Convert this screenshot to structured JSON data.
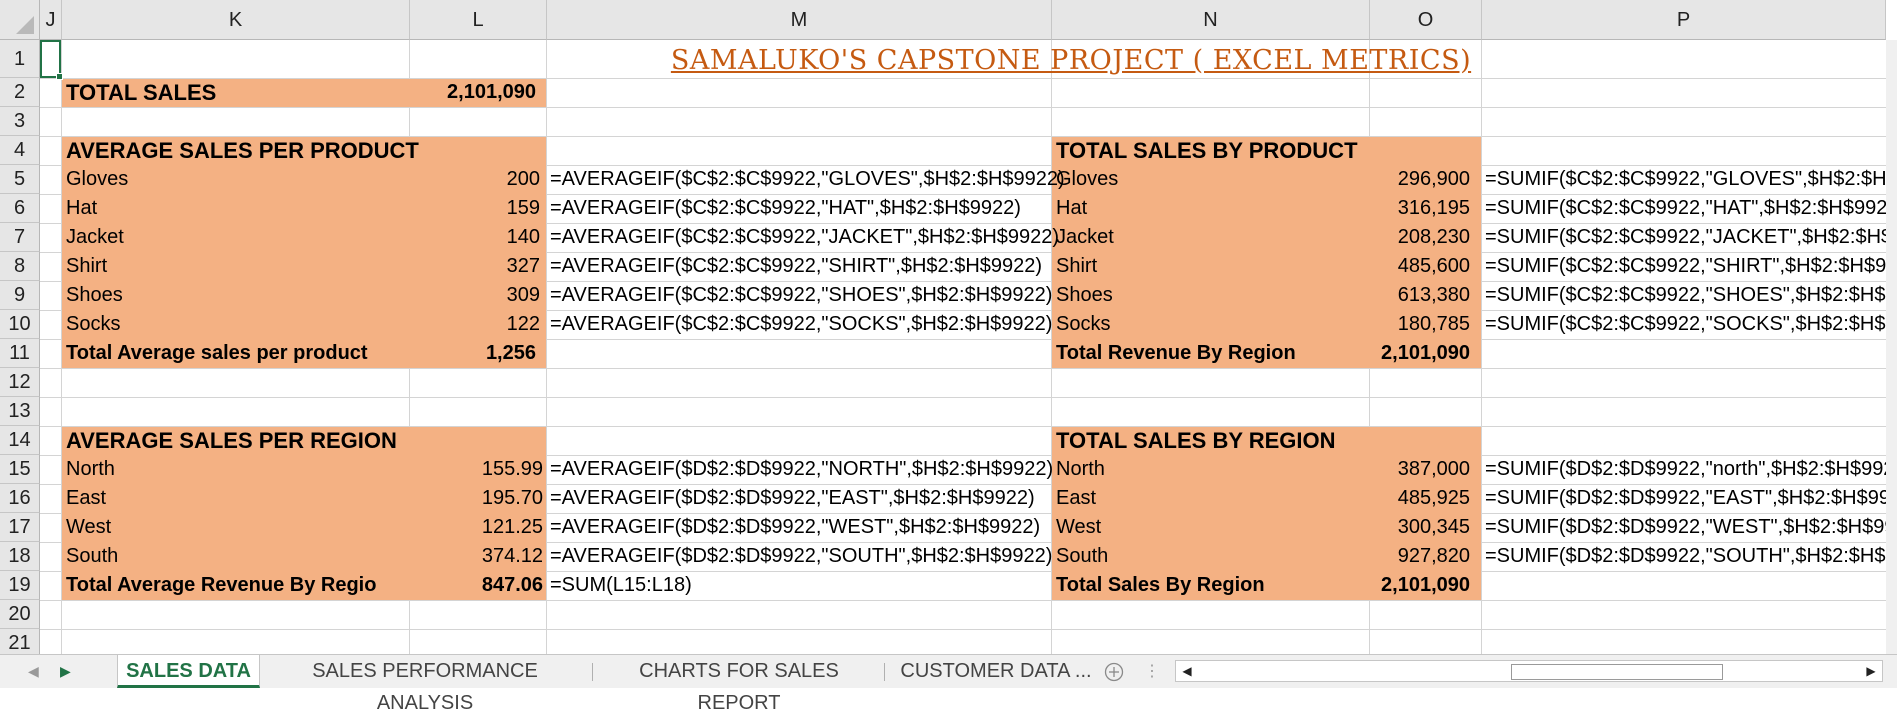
{
  "columns": [
    "J",
    "K",
    "L",
    "M",
    "N",
    "O",
    "P"
  ],
  "rows": [
    "1",
    "2",
    "3",
    "4",
    "5",
    "6",
    "7",
    "8",
    "9",
    "10",
    "11",
    "12",
    "13",
    "14",
    "15",
    "16",
    "17",
    "18",
    "19",
    "20",
    "21"
  ],
  "title": "SAMALUKO'S  CAPSTONE PROJECT ( EXCEL METRICS)",
  "total_sales": {
    "label": "TOTAL SALES",
    "value": "2,101,090"
  },
  "avg_product": {
    "header": "AVERAGE SALES PER PRODUCT",
    "items": [
      {
        "name": "Gloves",
        "value": "200",
        "formula": "=AVERAGEIF($C$2:$C$9922,\"GLOVES\",$H$2:$H$9922)"
      },
      {
        "name": "Hat",
        "value": "159",
        "formula": "=AVERAGEIF($C$2:$C$9922,\"HAT\",$H$2:$H$9922)"
      },
      {
        "name": "Jacket",
        "value": "140",
        "formula": "=AVERAGEIF($C$2:$C$9922,\"JACKET\",$H$2:$H$9922)"
      },
      {
        "name": "Shirt",
        "value": "327",
        "formula": "=AVERAGEIF($C$2:$C$9922,\"SHIRT\",$H$2:$H$9922)"
      },
      {
        "name": "Shoes",
        "value": "309",
        "formula": "=AVERAGEIF($C$2:$C$9922,\"SHOES\",$H$2:$H$9922)"
      },
      {
        "name": "Socks",
        "value": "122",
        "formula": "=AVERAGEIF($C$2:$C$9922,\"SOCKS\",$H$2:$H$9922)"
      }
    ],
    "total_label": "Total Average sales per product",
    "total_value": "1,256"
  },
  "total_product": {
    "header": "TOTAL SALES BY PRODUCT",
    "items": [
      {
        "name": "Gloves",
        "value": "296,900",
        "formula": "=SUMIF($C$2:$C$9922,\"GLOVES\",$H$2:$H$9"
      },
      {
        "name": "Hat",
        "value": "316,195",
        "formula": "=SUMIF($C$2:$C$9922,\"HAT\",$H$2:$H$9922"
      },
      {
        "name": "Jacket",
        "value": "208,230",
        "formula": "=SUMIF($C$2:$C$9922,\"JACKET\",$H$2:$H$99"
      },
      {
        "name": "Shirt",
        "value": "485,600",
        "formula": "=SUMIF($C$2:$C$9922,\"SHIRT\",$H$2:$H$992"
      },
      {
        "name": "Shoes",
        "value": "613,380",
        "formula": "=SUMIF($C$2:$C$9922,\"SHOES\",$H$2:$H$99"
      },
      {
        "name": "Socks",
        "value": "180,785",
        "formula": "=SUMIF($C$2:$C$9922,\"SOCKS\",$H$2:$H$99"
      }
    ],
    "total_label": "Total Revenue By Region",
    "total_value": "2,101,090"
  },
  "avg_region": {
    "header": "AVERAGE SALES PER REGION",
    "items": [
      {
        "name": "North",
        "value": "155.99",
        "formula": "=AVERAGEIF($D$2:$D$9922,\"NORTH\",$H$2:$H$9922)"
      },
      {
        "name": "East",
        "value": "195.70",
        "formula": "=AVERAGEIF($D$2:$D$9922,\"EAST\",$H$2:$H$9922)"
      },
      {
        "name": "West",
        "value": "121.25",
        "formula": "=AVERAGEIF($D$2:$D$9922,\"WEST\",$H$2:$H$9922)"
      },
      {
        "name": "South",
        "value": "374.12",
        "formula": "=AVERAGEIF($D$2:$D$9922,\"SOUTH\",$H$2:$H$9922)"
      }
    ],
    "total_label": "Total Average Revenue By Regio",
    "total_value": "847.06",
    "total_formula": "=SUM(L15:L18)"
  },
  "total_region": {
    "header": "TOTAL SALES BY REGION",
    "items": [
      {
        "name": "North",
        "value": "387,000",
        "formula": "=SUMIF($D$2:$D$9922,\"north\",$H$2:$H$992"
      },
      {
        "name": "East",
        "value": "485,925",
        "formula": "=SUMIF($D$2:$D$9922,\"EAST\",$H$2:$H$992"
      },
      {
        "name": "West",
        "value": "300,345",
        "formula": "=SUMIF($D$2:$D$9922,\"WEST\",$H$2:$H$99"
      },
      {
        "name": "South",
        "value": "927,820",
        "formula": "=SUMIF($D$2:$D$9922,\"SOUTH\",$H$2:$H$9"
      }
    ],
    "total_label": "Total Sales By Region",
    "total_value": "2,101,090"
  },
  "sheet_tabs": [
    {
      "label": "SALES DATA",
      "active": true
    },
    {
      "label": "SALES PERFORMANCE ANALYSIS",
      "active": false
    },
    {
      "label": "CHARTS FOR SALES REPORT",
      "active": false
    },
    {
      "label": "CUSTOMER DATA ...",
      "active": false
    }
  ],
  "add_sheet_icon": "plus-circle-icon",
  "colors": {
    "fill": "#f4b183",
    "title": "#c55a11",
    "accent": "#217346"
  }
}
